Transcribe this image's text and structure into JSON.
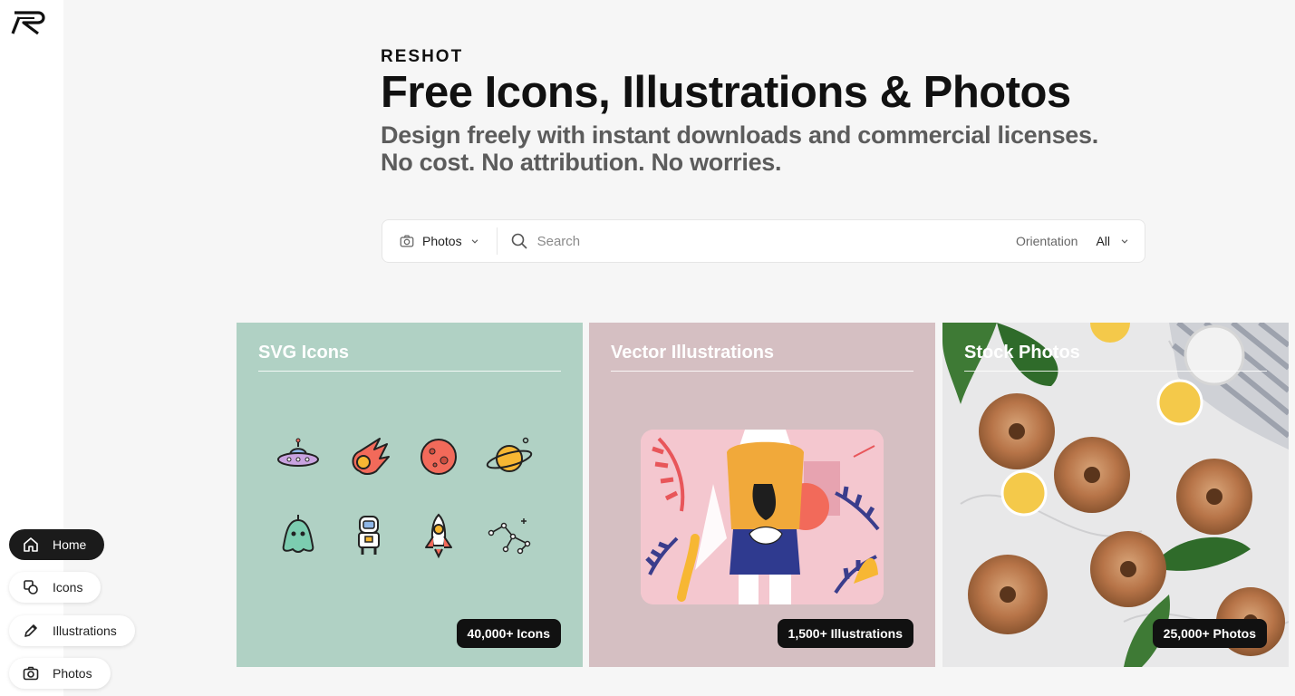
{
  "brand": "RESHOT",
  "hero": {
    "title": "Free Icons, Illustrations & Photos",
    "subtitle_line1": "Design freely with instant downloads and commercial licenses.",
    "subtitle_line2": "No cost. No attribution. No worries."
  },
  "search": {
    "type_selected": "Photos",
    "placeholder": "Search",
    "orientation_label": "Orientation",
    "orientation_value": "All"
  },
  "cards": [
    {
      "title": "SVG Icons",
      "count": "40,000+ Icons",
      "bg": "#b0d1c4"
    },
    {
      "title": "Vector Illustrations",
      "count": "1,500+ Illustrations",
      "bg": "#d5bfc2"
    },
    {
      "title": "Stock Photos",
      "count": "25,000+ Photos",
      "bg": "#e9e9ea"
    }
  ],
  "nav": [
    {
      "label": "Home",
      "icon": "home-icon",
      "active": true
    },
    {
      "label": "Icons",
      "icon": "shapes-icon",
      "active": false
    },
    {
      "label": "Illustrations",
      "icon": "pencil-icon",
      "active": false
    },
    {
      "label": "Photos",
      "icon": "camera-icon",
      "active": false
    }
  ],
  "colors": {
    "accent_dark": "#1b1b1b",
    "page_bg": "#f6f6f6"
  }
}
